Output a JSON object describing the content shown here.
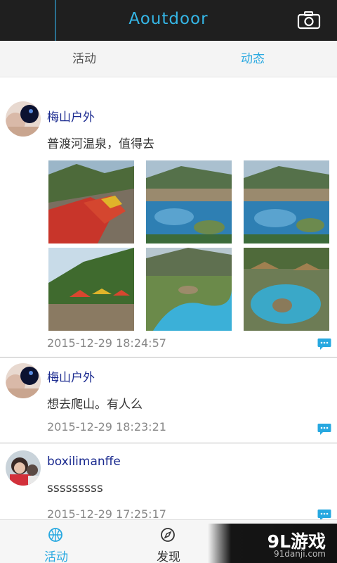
{
  "header": {
    "title": "Aoutdoor",
    "camera_icon": "camera-icon"
  },
  "tabs": [
    {
      "label": "活动",
      "active": false
    },
    {
      "label": "动态",
      "active": true
    }
  ],
  "posts": [
    {
      "username": "梅山户外",
      "content": "普渡河温泉，值得去",
      "time": "2015-12-29 18:24:57",
      "photo_count": 6
    },
    {
      "username": "梅山户外",
      "content": "想去爬山。有人么",
      "time": "2015-12-29 18:23:21"
    },
    {
      "username": "boxilimanffe",
      "content": "sssssssss",
      "time": "2015-12-29 17:25:17"
    }
  ],
  "bottom_nav": [
    {
      "label": "活动",
      "icon": "basketball-icon",
      "active": true
    },
    {
      "label": "发现",
      "icon": "compass-icon",
      "active": false
    }
  ],
  "watermark": {
    "logo": "9L游戏",
    "url": "91danji.com"
  },
  "colors": {
    "accent": "#27a8e0",
    "topbar": "#1f1f1f",
    "username": "#1a2a8f"
  }
}
